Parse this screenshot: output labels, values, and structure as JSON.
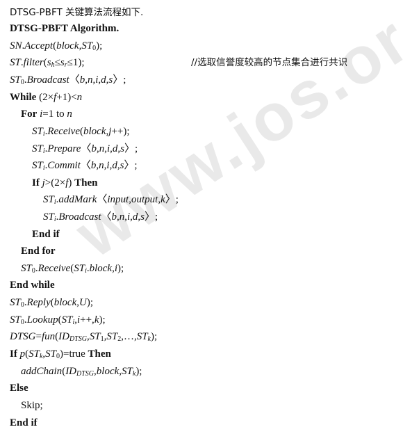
{
  "watermark": "www.jos.org.cn",
  "intro": "DTSG-PBFT 关键算法流程如下.",
  "algo_title": "DTSG-PBFT Algorithm.",
  "comment": "//选取信誉度较高的节点集合进行共识",
  "kw": {
    "while": "While",
    "for": "For",
    "if": "If",
    "then": "Then",
    "end_if": "End if",
    "end_for": "End for",
    "end_while": "End while",
    "else": "Else",
    "to": "to"
  },
  "skip": "Skip;"
}
